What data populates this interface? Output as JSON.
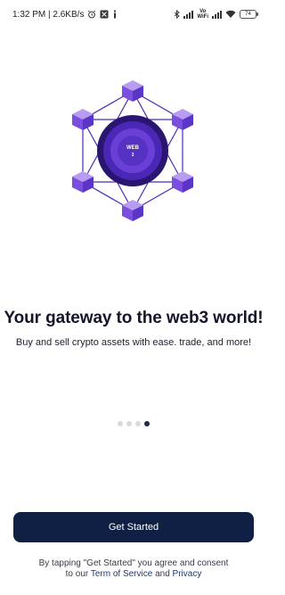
{
  "status_bar": {
    "time_speed": "1:32 PM | 2.6KB/s",
    "vowifi_top": "Vo",
    "vowifi_bottom": "WiFi",
    "battery": "74"
  },
  "hero": {
    "logo_top": "WEB",
    "logo_bottom": "3",
    "accent_color": "#6a3fd8",
    "dark_color": "#2a1670"
  },
  "onboarding": {
    "headline": "Your gateway to the web3 world!",
    "subtitle": "Buy and sell crypto assets with ease. trade, and more!",
    "page_count": 4,
    "active_page": 4
  },
  "cta": {
    "label": "Get Started"
  },
  "terms": {
    "line1": "By tapping \"Get Started\" you agree and consent",
    "prefix": "to our",
    "tos_link": "Term of Service",
    "and": "and",
    "privacy_link": "Privacy"
  }
}
